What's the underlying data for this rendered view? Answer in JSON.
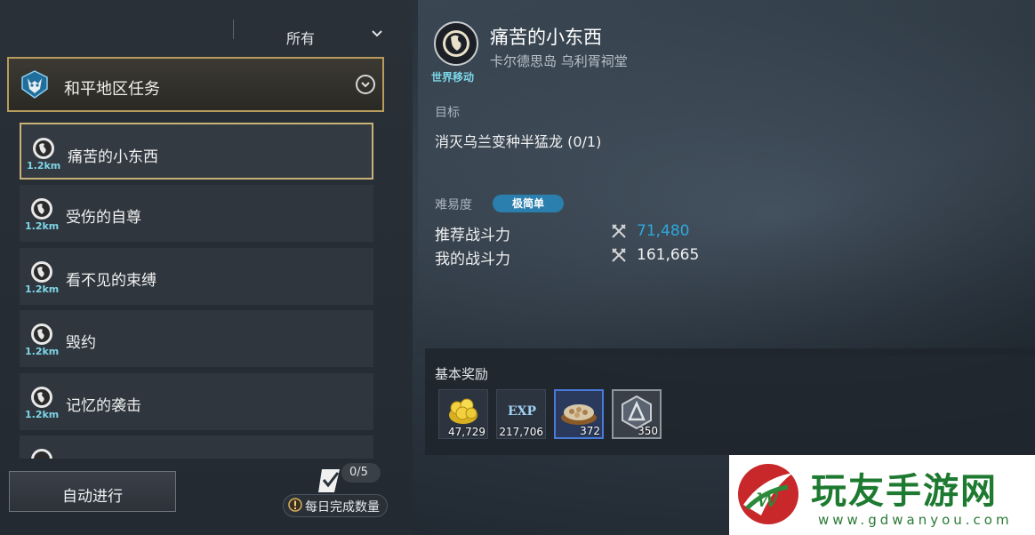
{
  "filter": {
    "label": "所有"
  },
  "category": {
    "label": "和平地区任务"
  },
  "quests": [
    {
      "name": "痛苦的小东西",
      "distance": "1.2km"
    },
    {
      "name": "受伤的自尊",
      "distance": "1.2km"
    },
    {
      "name": "看不见的束缚",
      "distance": "1.2km"
    },
    {
      "name": "毁约",
      "distance": "1.2km"
    },
    {
      "name": "记忆的袭击",
      "distance": "1.2km"
    }
  ],
  "actions": {
    "auto_label": "自动进行"
  },
  "daily": {
    "count": "0/5",
    "label": "每日完成数量"
  },
  "detail": {
    "type_tag": "世界移动",
    "title": "痛苦的小东西",
    "location": "卡尔德思岛 乌利胥祠堂",
    "objective_label": "目标",
    "objective_text": "消灭乌兰变种半猛龙 (0/1)",
    "difficulty_label": "难易度",
    "difficulty_value": "极简单",
    "recommended_power_label": "推荐战斗力",
    "recommended_power_value": "71,480",
    "my_power_label": "我的战斗力",
    "my_power_value": "161,665"
  },
  "rewards": {
    "label": "基本奖励",
    "items": [
      {
        "icon": "gold-coins-icon",
        "count": "47,729"
      },
      {
        "icon": "exp-icon",
        "text": "EXP",
        "count": "217,706"
      },
      {
        "icon": "food-bowl-icon",
        "count": "372"
      },
      {
        "icon": "emblem-icon",
        "count": "350"
      }
    ]
  },
  "watermark": {
    "title": "玩友手游网",
    "url": "www.gdwanyou.com"
  },
  "colors": {
    "accent_cyan": "#7dd6e8",
    "selected_border": "#c9b27a",
    "recommended_power": "#2ea8dc",
    "difficulty_badge": "#2b7fae"
  }
}
